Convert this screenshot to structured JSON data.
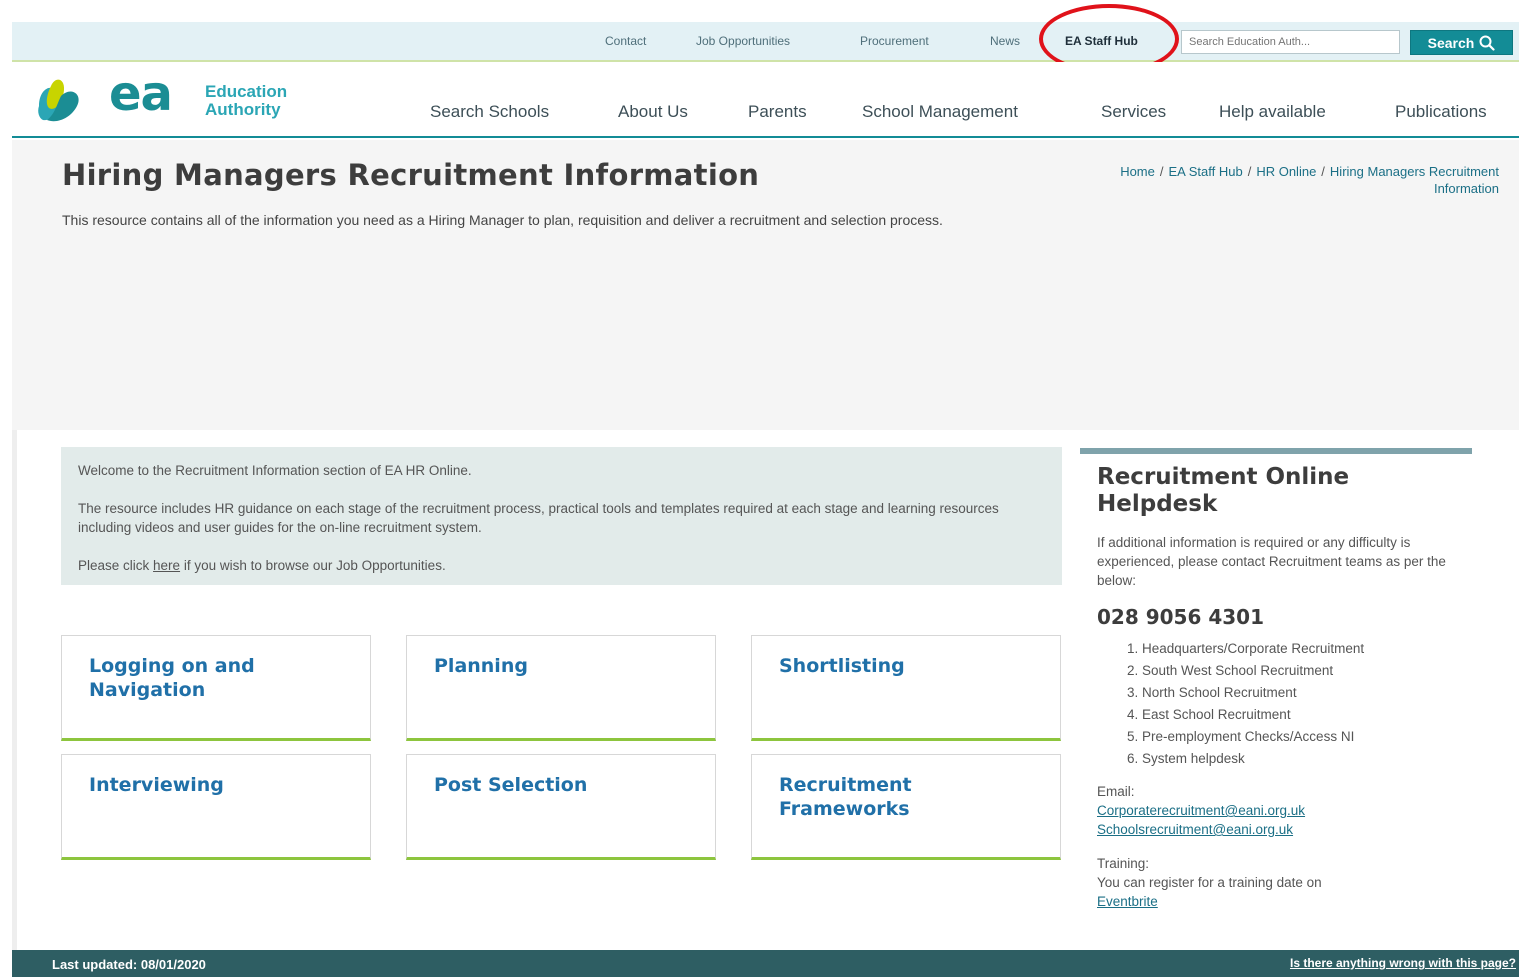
{
  "utility_nav": {
    "contact": "Contact",
    "jobs": "Job Opportunities",
    "procurement": "Procurement",
    "news": "News",
    "staff_hub": "EA Staff Hub",
    "search_placeholder": "Search Education Auth...",
    "search_button": "Search"
  },
  "logo": {
    "ea": "ea",
    "line1": "Education",
    "line2": "Authority"
  },
  "main_nav": {
    "search_schools": "Search Schools",
    "about_us": "About Us",
    "parents": "Parents",
    "school_management": "School Management",
    "services": "Services",
    "help_available": "Help available",
    "publications": "Publications"
  },
  "page": {
    "title": "Hiring Managers Recruitment Information",
    "intro": "This resource contains all of the information you need as a Hiring Manager to plan, requisition and deliver a recruitment and selection process."
  },
  "breadcrumb": {
    "home": "Home",
    "staff_hub": "EA Staff Hub",
    "hr_online": "HR Online",
    "current": "Hiring Managers Recruitment Information",
    "separator": "/"
  },
  "welcome": {
    "line1": "Welcome to the Recruitment Information section of EA HR Online.",
    "line2": "The resource includes HR guidance on each stage of the recruitment process, practical tools and templates required at each stage and learning resources including videos and user guides for the on-line recruitment system.",
    "line3_before": "Please click ",
    "line3_link": "here",
    "line3_after": " if you wish to browse our Job Opportunities."
  },
  "tiles": [
    "Logging on and Navigation",
    "Planning",
    "Shortlisting",
    "Interviewing",
    "Post Selection",
    "Recruitment Frameworks"
  ],
  "helpdesk": {
    "title": "Recruitment Online Helpdesk",
    "text": "If additional information is required or any difficulty is experienced, please contact Recruitment teams as per the below:",
    "phone": "028 9056 4301",
    "options": [
      "Headquarters/Corporate Recruitment",
      "South West School Recruitment",
      "North School Recruitment",
      "East School Recruitment",
      "Pre-employment Checks/Access NI",
      "System helpdesk"
    ],
    "email_label": "Email:",
    "email1": "Corporaterecruitment@eani.org.uk",
    "email2": "Schoolsrecruitment@eani.org.uk",
    "training_label": "Training:",
    "training_text": "You can register for a training date on",
    "training_link": "Eventbrite"
  },
  "footer": {
    "updated": "Last updated: 08/01/2020",
    "report": "Is there anything wrong with this page?"
  },
  "colors": {
    "accent": "#138c96",
    "tile_title": "#2070a8",
    "tile_border": "#8dc53e",
    "footer_bg": "#2e5e63",
    "highlight": "#e0121a"
  },
  "icons": {
    "search": "search-icon",
    "logo": "ea-logo-icon"
  }
}
